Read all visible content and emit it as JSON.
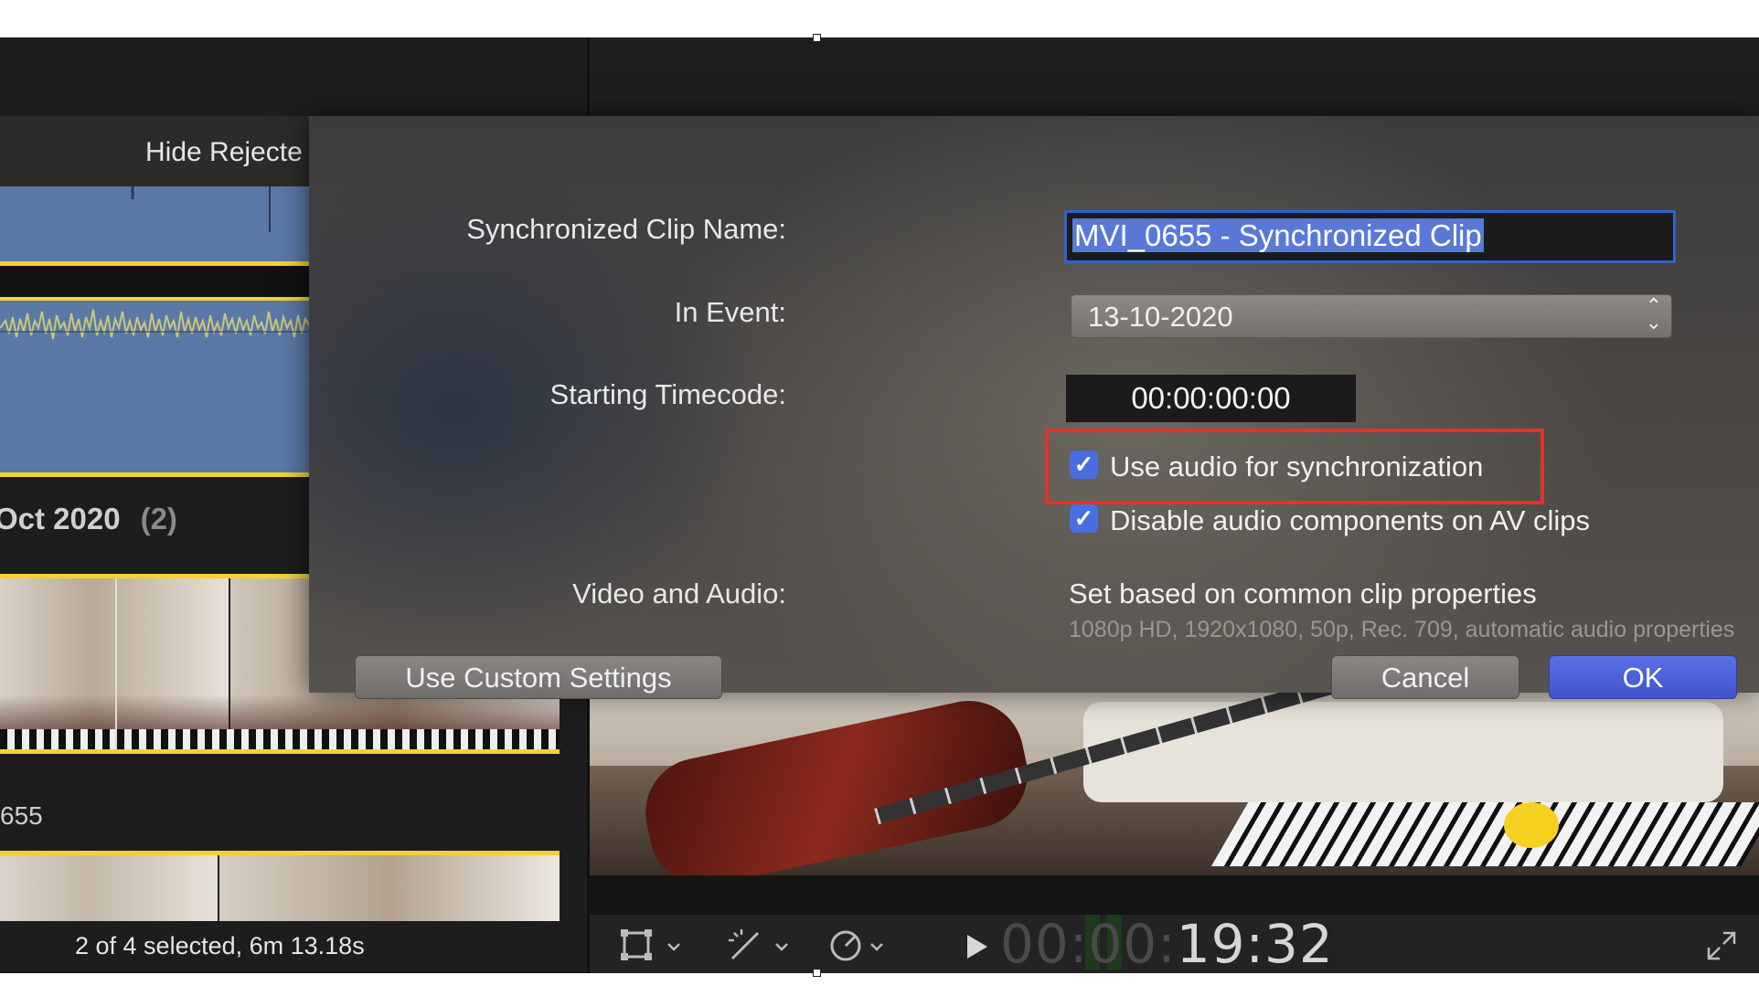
{
  "browser": {
    "toolbar": {
      "hide_rejected_label": "Hide Rejecte"
    },
    "event_header": {
      "date": "Oct 2020",
      "count": "(2)"
    },
    "clip_name": "655",
    "status": "2 of 4 selected, 6m 13.18s"
  },
  "dialog": {
    "clip_name_label": "Synchronized Clip Name:",
    "clip_name_value": "MVI_0655 - Synchronized Clip",
    "in_event_label": "In Event:",
    "in_event_value": "13-10-2020",
    "starting_timecode_label": "Starting Timecode:",
    "starting_timecode_value": "00:00:00:00",
    "use_audio_sync_label": "Use audio for synchronization",
    "use_audio_sync_checked": true,
    "disable_audio_label": "Disable audio components on AV clips",
    "disable_audio_checked": true,
    "video_audio_label": "Video and Audio:",
    "video_audio_value": "Set based on common clip properties",
    "video_audio_detail": "1080p HD, 1920x1080, 50p, Rec. 709, automatic audio properties",
    "custom_settings_button": "Use Custom Settings",
    "cancel_button": "Cancel",
    "ok_button": "OK",
    "checkmark_glyph": "✓"
  },
  "viewer": {
    "timecode_dim": "00:00:",
    "timecode_bright": "19:32"
  },
  "colors": {
    "accent_blue": "#4a6ee0",
    "highlight_red": "#e0342a",
    "clip_yellow": "#f4d233",
    "waveform_blue": "#5a78a6"
  }
}
